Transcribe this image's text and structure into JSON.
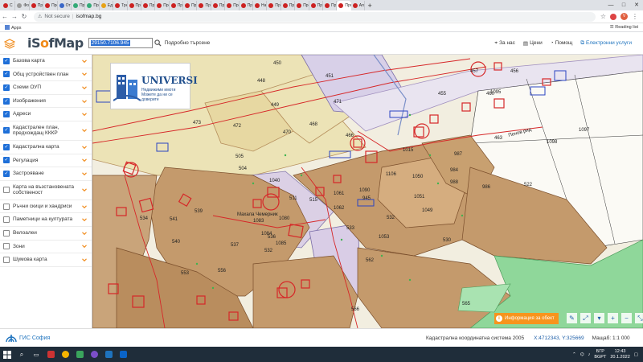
{
  "browser": {
    "tabs": [
      {
        "label": "С",
        "fav": "r"
      },
      {
        "label": "Фон",
        "fav": "w"
      },
      {
        "label": "Про",
        "fav": "r"
      },
      {
        "label": "Про",
        "fav": "r"
      },
      {
        "label": "От п",
        "fav": "b"
      },
      {
        "label": "Про",
        "fav": "g"
      },
      {
        "label": "Про",
        "fav": "g"
      },
      {
        "label": "Едн",
        "fav": "y"
      },
      {
        "label": "Трн",
        "fav": "r"
      },
      {
        "label": "Про",
        "fav": "r"
      },
      {
        "label": "Про",
        "fav": "r"
      },
      {
        "label": "Про",
        "fav": "r"
      },
      {
        "label": "Про",
        "fav": "r"
      },
      {
        "label": "Про",
        "fav": "r"
      },
      {
        "label": "Про",
        "fav": "r"
      },
      {
        "label": "Про",
        "fav": "r"
      },
      {
        "label": "Про",
        "fav": "r"
      },
      {
        "label": "Про",
        "fav": "r"
      },
      {
        "label": "Нач",
        "fav": "r"
      },
      {
        "label": "Про",
        "fav": "r"
      },
      {
        "label": "Про",
        "fav": "r"
      },
      {
        "label": "Про",
        "fav": "r"
      },
      {
        "label": "Про",
        "fav": "r"
      },
      {
        "label": "Про",
        "fav": "r"
      },
      {
        "label": "Про",
        "fav": "r"
      },
      {
        "label": "Апо",
        "fav": "r"
      }
    ],
    "active_tab_close": "×",
    "new_tab": "+",
    "window_controls": [
      "—",
      "□",
      "✕"
    ],
    "security": "Not secure",
    "url": "isofmap.bg",
    "profile_initial": "V",
    "bookmarks_apps": "Apps",
    "reading_list": "Reading list"
  },
  "app": {
    "logo_prefix": "iS",
    "logo_o": "o",
    "logo_suffix": "fMap",
    "search_value": "29150.7106.945",
    "advanced_search": "Подробно търсене",
    "links": [
      {
        "label": "За нас",
        "icon": "map-pin-icon"
      },
      {
        "label": "Цени",
        "icon": "price-tag-icon"
      },
      {
        "label": "Помощ",
        "icon": "help-icon"
      },
      {
        "label": "Електронни услуги",
        "icon": "external-link-icon"
      }
    ]
  },
  "layers": [
    {
      "label": "Базова карта",
      "checked": true
    },
    {
      "label": "Общ устройствен план",
      "checked": true
    },
    {
      "label": "Схеми ОУП",
      "checked": true
    },
    {
      "label": "Изображения",
      "checked": true
    },
    {
      "label": "Адреси",
      "checked": true
    },
    {
      "label": "Кадастрален план, предхождащ КККР",
      "checked": true
    },
    {
      "label": "Кадастрална карта",
      "checked": true
    },
    {
      "label": "Регулация",
      "checked": true
    },
    {
      "label": "Застрояване",
      "checked": true
    },
    {
      "label": "Карта на възстановената собственост",
      "checked": false
    },
    {
      "label": "Ръчни скици и хандриси",
      "checked": false
    },
    {
      "label": "Паметници на културата",
      "checked": false
    },
    {
      "label": "Велоалеи",
      "checked": false
    },
    {
      "label": "Зони",
      "checked": false
    },
    {
      "label": "Шумова карта",
      "checked": false
    }
  ],
  "map": {
    "logo_card_title": "UNIVERSI",
    "logo_card_sub1": "Недвижими имоти",
    "logo_card_sub2": "Можете да ни се доверите",
    "street_label": "Пенов рид",
    "street_label2": "Махала Чемерник",
    "info_button": "Информация за обект",
    "parcels": [
      "450",
      "448",
      "449",
      "473",
      "472",
      "470",
      "468",
      "466",
      "471",
      "455",
      "451",
      "457",
      "456",
      "460",
      "1095",
      "1097",
      "1098",
      "463",
      "505",
      "504",
      "539",
      "540",
      "537",
      "536",
      "541",
      "534",
      "533",
      "532",
      "530",
      "522",
      "562",
      "565",
      "566",
      "553",
      "556",
      "1085",
      "1050",
      "984",
      "986",
      "945",
      "1061",
      "1049",
      "1080",
      "1083",
      "1084",
      "511",
      "515",
      "1040",
      "1015",
      "987",
      "988",
      "1106",
      "1051",
      "1062",
      "1053",
      "1090",
      "532",
      "1064",
      "1060",
      "1027",
      "1019",
      "1092",
      "1093",
      "1094",
      "12",
      "13",
      "14",
      "15",
      "22",
      "23",
      "28",
      "31",
      "33",
      "41",
      "42",
      "44",
      "45"
    ],
    "tools": [
      "✎",
      "⤢",
      "▾",
      "+",
      "−",
      "⤡"
    ]
  },
  "status": {
    "gis_name": "ГИС София",
    "coord_system": "Кадастрална координатна система 2005",
    "coords": "X:4712343, Y:325669",
    "scale_label": "Мащаб: 1:1 000"
  },
  "taskbar": {
    "lang": "БГР\nBGPT",
    "time": "12:43",
    "date": "20.1.2022"
  },
  "colors": {
    "accent": "#1e73be",
    "orange": "#f7941d",
    "checkbox": "#1e6fd8",
    "parcel_tan": "#c49a6c",
    "parcel_light": "#ece0b8",
    "forest_green": "#8fd79a",
    "regulation_red": "#d62728"
  }
}
